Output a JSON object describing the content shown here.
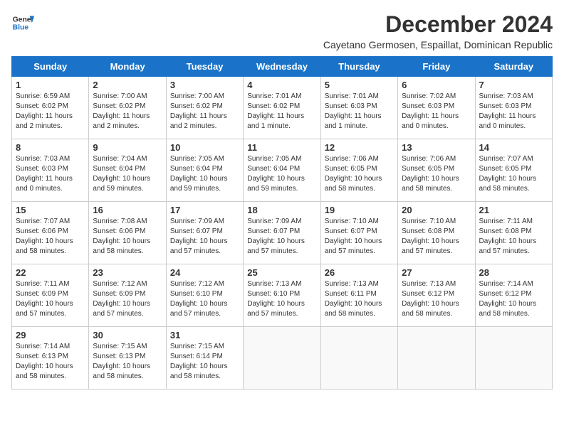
{
  "logo": {
    "line1": "General",
    "line2": "Blue"
  },
  "title": "December 2024",
  "subtitle": "Cayetano Germosen, Espaillat, Dominican Republic",
  "weekdays": [
    "Sunday",
    "Monday",
    "Tuesday",
    "Wednesday",
    "Thursday",
    "Friday",
    "Saturday"
  ],
  "weeks": [
    [
      {
        "day": 1,
        "info": "Sunrise: 6:59 AM\nSunset: 6:02 PM\nDaylight: 11 hours\nand 2 minutes."
      },
      {
        "day": 2,
        "info": "Sunrise: 7:00 AM\nSunset: 6:02 PM\nDaylight: 11 hours\nand 2 minutes."
      },
      {
        "day": 3,
        "info": "Sunrise: 7:00 AM\nSunset: 6:02 PM\nDaylight: 11 hours\nand 2 minutes."
      },
      {
        "day": 4,
        "info": "Sunrise: 7:01 AM\nSunset: 6:02 PM\nDaylight: 11 hours\nand 1 minute."
      },
      {
        "day": 5,
        "info": "Sunrise: 7:01 AM\nSunset: 6:03 PM\nDaylight: 11 hours\nand 1 minute."
      },
      {
        "day": 6,
        "info": "Sunrise: 7:02 AM\nSunset: 6:03 PM\nDaylight: 11 hours\nand 0 minutes."
      },
      {
        "day": 7,
        "info": "Sunrise: 7:03 AM\nSunset: 6:03 PM\nDaylight: 11 hours\nand 0 minutes."
      }
    ],
    [
      {
        "day": 8,
        "info": "Sunrise: 7:03 AM\nSunset: 6:03 PM\nDaylight: 11 hours\nand 0 minutes."
      },
      {
        "day": 9,
        "info": "Sunrise: 7:04 AM\nSunset: 6:04 PM\nDaylight: 10 hours\nand 59 minutes."
      },
      {
        "day": 10,
        "info": "Sunrise: 7:05 AM\nSunset: 6:04 PM\nDaylight: 10 hours\nand 59 minutes."
      },
      {
        "day": 11,
        "info": "Sunrise: 7:05 AM\nSunset: 6:04 PM\nDaylight: 10 hours\nand 59 minutes."
      },
      {
        "day": 12,
        "info": "Sunrise: 7:06 AM\nSunset: 6:05 PM\nDaylight: 10 hours\nand 58 minutes."
      },
      {
        "day": 13,
        "info": "Sunrise: 7:06 AM\nSunset: 6:05 PM\nDaylight: 10 hours\nand 58 minutes."
      },
      {
        "day": 14,
        "info": "Sunrise: 7:07 AM\nSunset: 6:05 PM\nDaylight: 10 hours\nand 58 minutes."
      }
    ],
    [
      {
        "day": 15,
        "info": "Sunrise: 7:07 AM\nSunset: 6:06 PM\nDaylight: 10 hours\nand 58 minutes."
      },
      {
        "day": 16,
        "info": "Sunrise: 7:08 AM\nSunset: 6:06 PM\nDaylight: 10 hours\nand 58 minutes."
      },
      {
        "day": 17,
        "info": "Sunrise: 7:09 AM\nSunset: 6:07 PM\nDaylight: 10 hours\nand 57 minutes."
      },
      {
        "day": 18,
        "info": "Sunrise: 7:09 AM\nSunset: 6:07 PM\nDaylight: 10 hours\nand 57 minutes."
      },
      {
        "day": 19,
        "info": "Sunrise: 7:10 AM\nSunset: 6:07 PM\nDaylight: 10 hours\nand 57 minutes."
      },
      {
        "day": 20,
        "info": "Sunrise: 7:10 AM\nSunset: 6:08 PM\nDaylight: 10 hours\nand 57 minutes."
      },
      {
        "day": 21,
        "info": "Sunrise: 7:11 AM\nSunset: 6:08 PM\nDaylight: 10 hours\nand 57 minutes."
      }
    ],
    [
      {
        "day": 22,
        "info": "Sunrise: 7:11 AM\nSunset: 6:09 PM\nDaylight: 10 hours\nand 57 minutes."
      },
      {
        "day": 23,
        "info": "Sunrise: 7:12 AM\nSunset: 6:09 PM\nDaylight: 10 hours\nand 57 minutes."
      },
      {
        "day": 24,
        "info": "Sunrise: 7:12 AM\nSunset: 6:10 PM\nDaylight: 10 hours\nand 57 minutes."
      },
      {
        "day": 25,
        "info": "Sunrise: 7:13 AM\nSunset: 6:10 PM\nDaylight: 10 hours\nand 57 minutes."
      },
      {
        "day": 26,
        "info": "Sunrise: 7:13 AM\nSunset: 6:11 PM\nDaylight: 10 hours\nand 58 minutes."
      },
      {
        "day": 27,
        "info": "Sunrise: 7:13 AM\nSunset: 6:12 PM\nDaylight: 10 hours\nand 58 minutes."
      },
      {
        "day": 28,
        "info": "Sunrise: 7:14 AM\nSunset: 6:12 PM\nDaylight: 10 hours\nand 58 minutes."
      }
    ],
    [
      {
        "day": 29,
        "info": "Sunrise: 7:14 AM\nSunset: 6:13 PM\nDaylight: 10 hours\nand 58 minutes."
      },
      {
        "day": 30,
        "info": "Sunrise: 7:15 AM\nSunset: 6:13 PM\nDaylight: 10 hours\nand 58 minutes."
      },
      {
        "day": 31,
        "info": "Sunrise: 7:15 AM\nSunset: 6:14 PM\nDaylight: 10 hours\nand 58 minutes."
      },
      null,
      null,
      null,
      null
    ]
  ]
}
